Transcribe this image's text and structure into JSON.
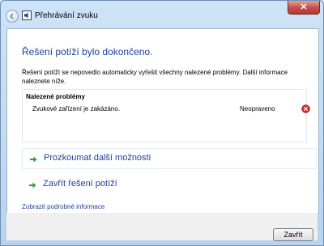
{
  "window": {
    "title": "Přehrávání zvuku",
    "close_symbol": "✕"
  },
  "content": {
    "heading": "Řešení potíží bylo dokončeno.",
    "description": "Řešení potíží se nepovedlo automaticky vyřešit všechny nalezené problémy. Další informace naleznete níže.",
    "problems": {
      "header": "Nalezené problémy",
      "items": [
        {
          "name": "Zvukové zařízení je zakázáno.",
          "status": "Neopraveno",
          "status_icon": "error-icon"
        }
      ]
    },
    "links": {
      "explore": "Prozkoumat další možnosti",
      "close_troubleshooting": "Zavřít řešení potíží",
      "details": "Zobrazit podrobné informace"
    }
  },
  "footer": {
    "close_button": "Zavřít"
  },
  "colors": {
    "accent": "#1e3f9b",
    "link_arrow": "#2ea12e",
    "error": "#d12b2b"
  }
}
